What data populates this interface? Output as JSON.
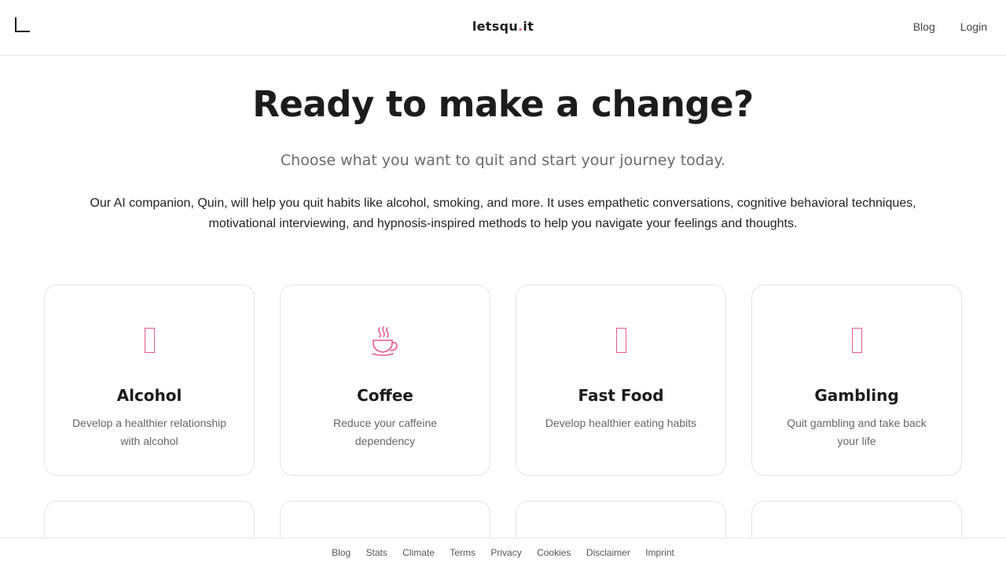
{
  "header": {
    "brand_prefix": "letsqu",
    "brand_dot": ".",
    "brand_suffix": "it",
    "nav": [
      "Blog",
      "Login"
    ]
  },
  "hero": {
    "title": "Ready to make a change?",
    "subtitle": "Choose what you want to quit and start your journey today.",
    "description": "Our AI companion, Quin, will help you quit habits like alcohol, smoking, and more. It uses empathetic conversations, cognitive behavioral techniques, motivational interviewing, and hypnosis-inspired methods to help you navigate your feelings and thoughts."
  },
  "cards": [
    {
      "icon": "missing-glyph-icon",
      "title": "Alcohol",
      "desc": "Develop a healthier relationship with alcohol"
    },
    {
      "icon": "coffee-cup-icon",
      "title": "Coffee",
      "desc": "Reduce your caffeine dependency"
    },
    {
      "icon": "missing-glyph-icon",
      "title": "Fast Food",
      "desc": "Develop healthier eating habits"
    },
    {
      "icon": "missing-glyph-icon",
      "title": "Gambling",
      "desc": "Quit gambling and take back your life"
    }
  ],
  "footer": {
    "links": [
      "Blog",
      "Stats",
      "Climate",
      "Terms",
      "Privacy",
      "Cookies",
      "Disclaimer",
      "Imprint"
    ]
  },
  "colors": {
    "accent": "#e8578e",
    "text": "#1c1c1c",
    "muted": "#666666",
    "border": "#e4e4e4"
  }
}
